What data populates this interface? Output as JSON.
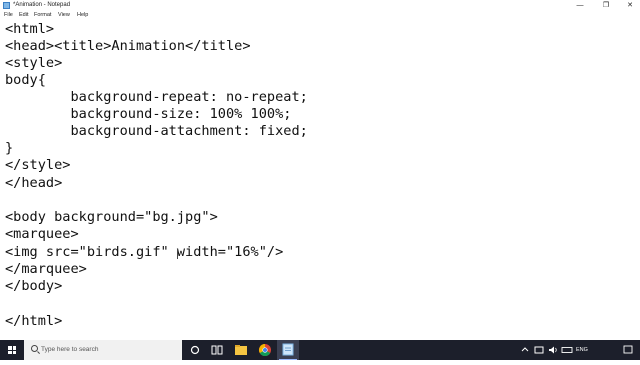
{
  "window": {
    "title": "*Animation - Notepad",
    "controls": {
      "minimize": "—",
      "restore": "❐",
      "close": "✕"
    }
  },
  "menu": [
    "File",
    "Edit",
    "Format",
    "View",
    "Help"
  ],
  "editor": {
    "lines": [
      "<html>",
      "<head><title>Animation</title>",
      "<style>",
      "body{",
      "        background-repeat: no-repeat;",
      "        background-size: 100% 100%;",
      "        background-attachment: fixed;",
      "}",
      "</style>",
      "</head>",
      "",
      "<body background=\"bg.jpg\">",
      "<marquee>",
      "<img src=\"birds.gif\" width=\"16%\"/>",
      "</marquee>",
      "</body>",
      "",
      "</html>"
    ]
  },
  "taskbar": {
    "search_placeholder": "Type here to search",
    "icons": [
      "start-icon",
      "search-icon",
      "cortana-icon",
      "task-view-icon",
      "file-explorer-icon",
      "chrome-icon",
      "notepad-icon"
    ],
    "tray": {
      "language": "ENG"
    }
  }
}
